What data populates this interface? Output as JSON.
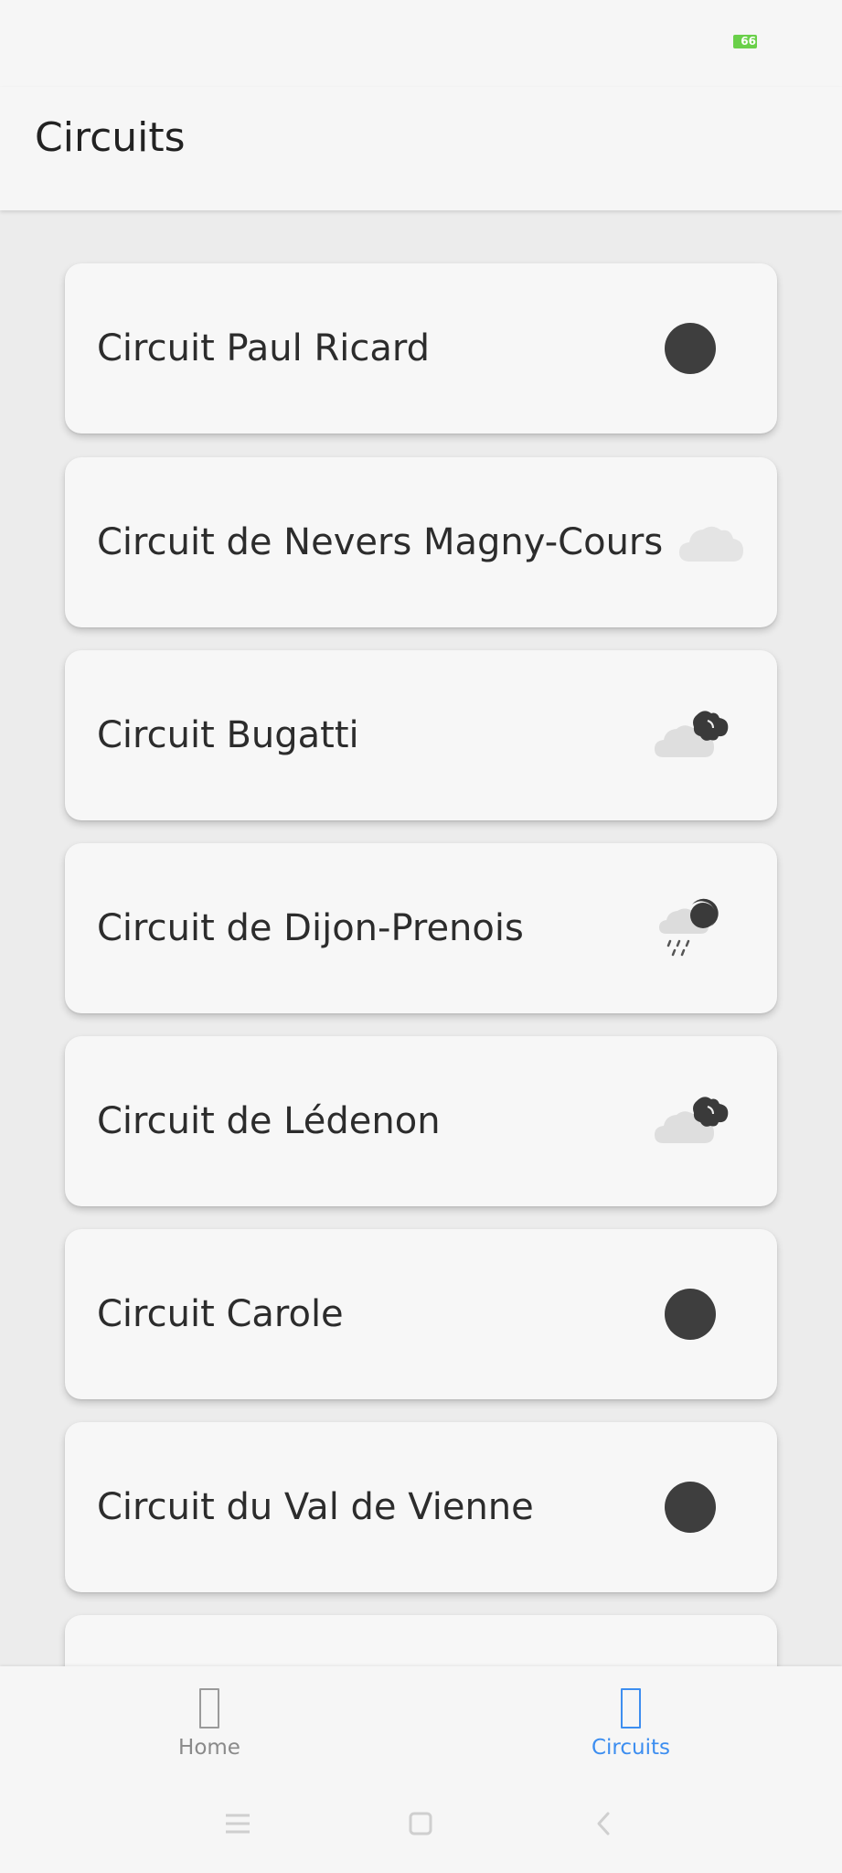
{
  "status_bar": {
    "battery_level": "66",
    "battery_color": "#6ad04a"
  },
  "header": {
    "title": "Circuits"
  },
  "circuits": [
    {
      "name": "Circuit Paul Ricard",
      "weather_icon": "dark-circle-icon"
    },
    {
      "name": "Circuit de Nevers Magny-Cours",
      "weather_icon": "cloud-icon"
    },
    {
      "name": "Circuit Bugatti",
      "weather_icon": "cloud-moon-icon"
    },
    {
      "name": "Circuit de Dijon-Prenois",
      "weather_icon": "rain-moon-icon"
    },
    {
      "name": "Circuit de Lédenon",
      "weather_icon": "cloud-moon-icon"
    },
    {
      "name": "Circuit Carole",
      "weather_icon": "dark-circle-icon"
    },
    {
      "name": "Circuit du Val de Vienne",
      "weather_icon": "dark-circle-icon"
    }
  ],
  "bottom_nav": {
    "items": [
      {
        "label": "Home",
        "icon": "home-icon",
        "active": false
      },
      {
        "label": "Circuits",
        "icon": "circuits-icon",
        "active": true
      }
    ],
    "active_color": "#3d8ef0",
    "inactive_color": "#8a8a8a"
  },
  "system_nav": {
    "icons": [
      "menu-icon",
      "home-square-icon",
      "back-icon"
    ]
  }
}
